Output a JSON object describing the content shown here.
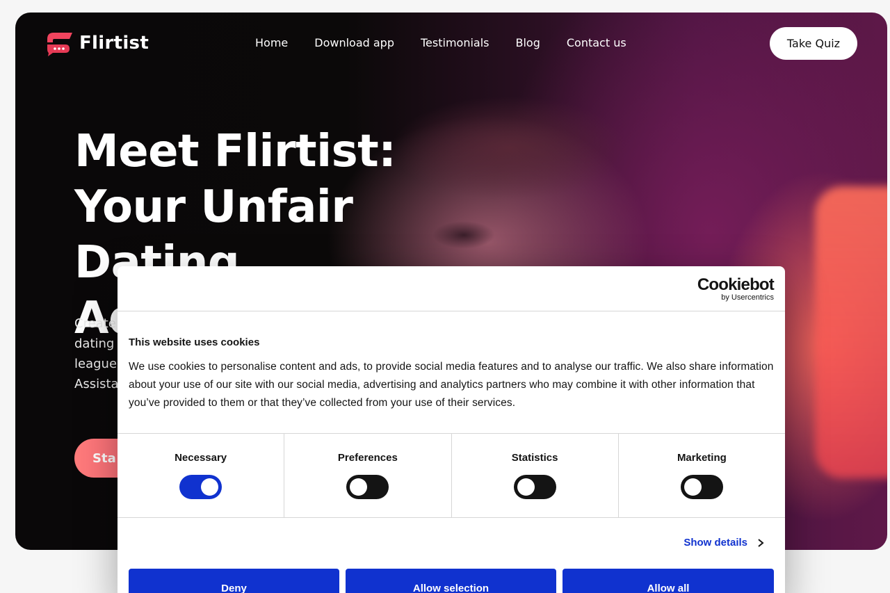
{
  "brand": {
    "name": "Flirtist",
    "accent": "#f0445e"
  },
  "nav": {
    "items": [
      "Home",
      "Download app",
      "Testimonials",
      "Blog",
      "Contact us"
    ],
    "cta": "Take Quiz"
  },
  "hero": {
    "headline": "Meet Flirtist: Your Unfair Dating Advantage",
    "subtext_visible": [
      "Create",
      "dating",
      "league",
      "Assista"
    ],
    "start_button": "Sta"
  },
  "cookie_dialog": {
    "logo": {
      "name": "Cookiebot",
      "by": "by Usercentrics"
    },
    "title": "This website uses cookies",
    "description": "We use cookies to personalise content and ads, to provide social media features and to analyse our traffic. We also share information about your use of our site with our social media, advertising and analytics partners who may combine it with other information that you’ve provided to them or that they’ve collected from your use of their services.",
    "categories": [
      {
        "label": "Necessary",
        "enabled": true
      },
      {
        "label": "Preferences",
        "enabled": false
      },
      {
        "label": "Statistics",
        "enabled": false
      },
      {
        "label": "Marketing",
        "enabled": false
      }
    ],
    "show_details": "Show details",
    "buttons": {
      "deny": "Deny",
      "allow_selection": "Allow selection",
      "allow_all": "Allow all"
    },
    "button_color": "#1032cf"
  }
}
